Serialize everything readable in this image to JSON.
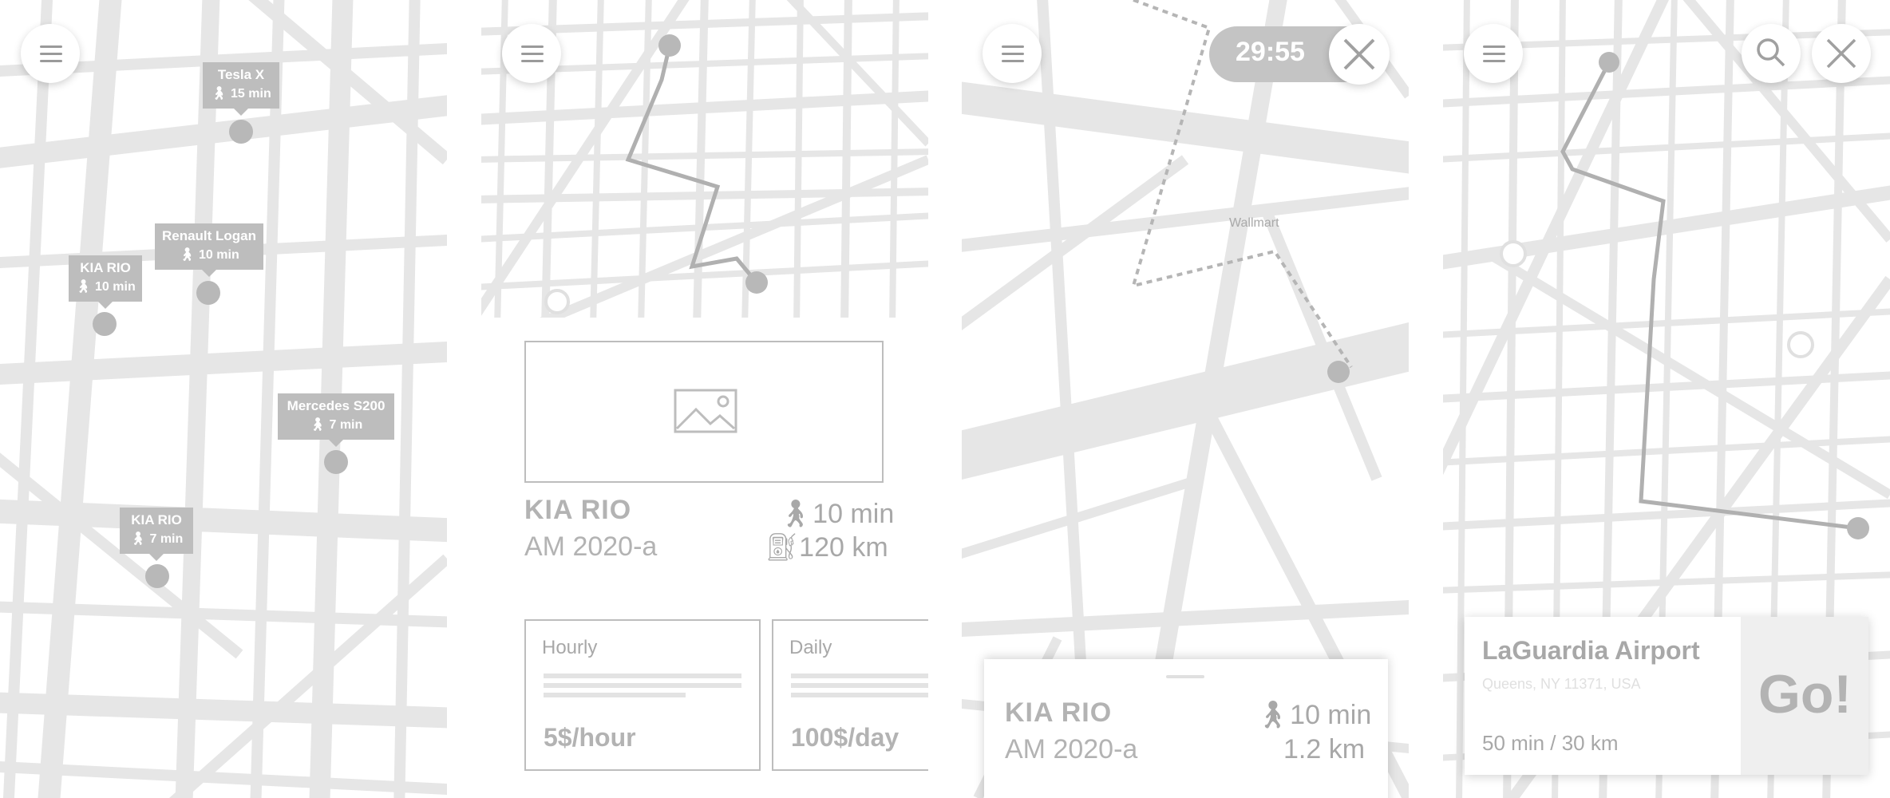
{
  "screen1": {
    "cars": [
      {
        "name": "Tesla X",
        "eta": "15 min"
      },
      {
        "name": "Renault Logan",
        "eta": "10 min"
      },
      {
        "name": "KIA RIO",
        "eta": "10 min"
      },
      {
        "name": "Mercedes S200",
        "eta": "7 min"
      },
      {
        "name": "KIA RIO",
        "eta": "7 min"
      }
    ]
  },
  "screen2": {
    "car_name": "KIA RIO",
    "car_plate": "AM 2020-a",
    "walk_time": "10 min",
    "fuel_range": "120 km",
    "rates": [
      {
        "title": "Hourly",
        "price": "5$/hour"
      },
      {
        "title": "Daily",
        "price": "100$/day"
      }
    ]
  },
  "screen3": {
    "timer": "29:55",
    "place_label": "Wallmart",
    "car_name": "KIA RIO",
    "car_plate": "AM 2020-a",
    "walk_time": "10 min",
    "distance": "1.2 km"
  },
  "screen4": {
    "destination": "LaGuardia Airport",
    "address": "Queens, NY 11371, USA",
    "trip_meta": "50 min / 30 km",
    "go_label": "Go!"
  },
  "icons": {
    "menu": "hamburger-menu-icon",
    "walk": "walking-person-icon",
    "fuel": "fuel-pump-icon",
    "image": "image-placeholder-icon",
    "close": "close-icon",
    "search": "search-icon"
  },
  "colors": {
    "map_road": "#e8e8e8",
    "route": "#b0b0b0",
    "pin": "#bdbdbd",
    "text": "#a8a8a8"
  }
}
